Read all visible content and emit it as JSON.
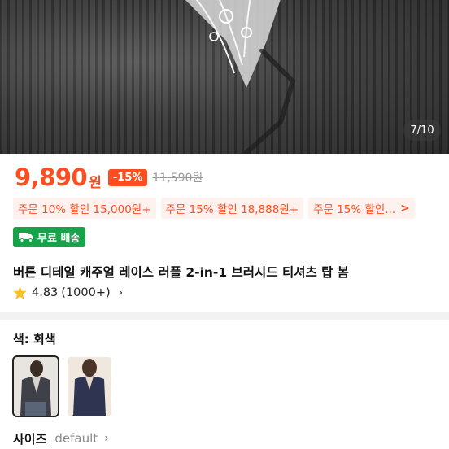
{
  "gallery": {
    "counter": "7/10"
  },
  "price": {
    "amount": "9,890",
    "currency": "원",
    "discount": "-15%",
    "original": "11,590원"
  },
  "coupons": [
    {
      "label": "주문 10% 할인 15,000원+"
    },
    {
      "label": "주문 15% 할인 18,888원+"
    },
    {
      "label": "주문 15% 할인..."
    }
  ],
  "coupon_more": ">",
  "shipping": {
    "label": "무료 배송",
    "icon": "truck-icon",
    "color": "#17a34a"
  },
  "product": {
    "title": "버튼 디테일 캐주얼 레이스 러플 2-in-1 브러시드 티셔츠 탑 봄"
  },
  "rating": {
    "score": "4.83",
    "count": "(1000+)",
    "icon": "star-icon"
  },
  "options": {
    "color_label": "색: 회색",
    "swatches": [
      {
        "name": "회색",
        "selected": true
      },
      {
        "name": "네이비",
        "selected": false
      }
    ],
    "size_label": "사이즈",
    "size_value": "default"
  },
  "colors": {
    "accent": "#ff4d22",
    "coupon_bg": "#fff2ee",
    "shipping": "#17a34a",
    "star": "#f6c21c"
  }
}
